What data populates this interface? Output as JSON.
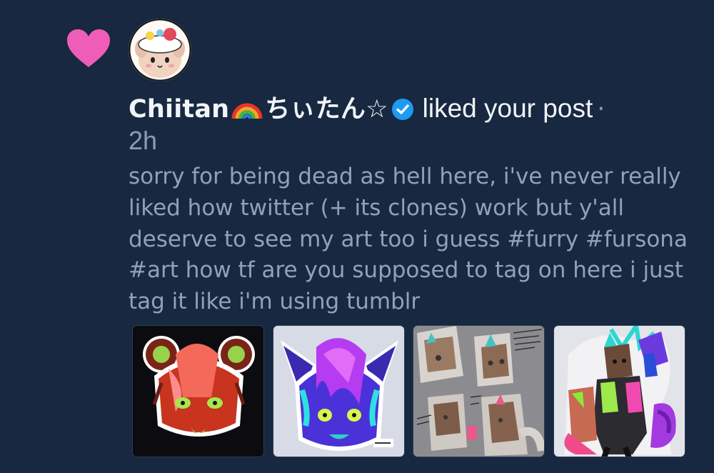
{
  "notification": {
    "reaction_icon": "heart-icon",
    "reaction_color": "#f05db8",
    "display_name": "Chiitan",
    "display_name_suffix": "ちぃたん☆",
    "verified": true,
    "verified_color": "#1d9bf0",
    "action_text": "liked your post",
    "separator": "·",
    "time": "2h"
  },
  "post": {
    "text": "sorry for being dead as hell here, i've never really liked how twitter (+ its clones) work but y'all deserve to see my art too i guess #furry #fursona #art how tf are you supposed to tag on here i just tag it like i'm using tumblr"
  },
  "media": {
    "count": 4,
    "images": [
      "fursona-headshot-red",
      "fursona-headshot-purple",
      "fursona-reference-sketch",
      "fursona-full-body-group"
    ]
  },
  "colors": {
    "background": "#172840",
    "text_primary": "#f1f4f8",
    "text_secondary": "#92a2b5"
  }
}
